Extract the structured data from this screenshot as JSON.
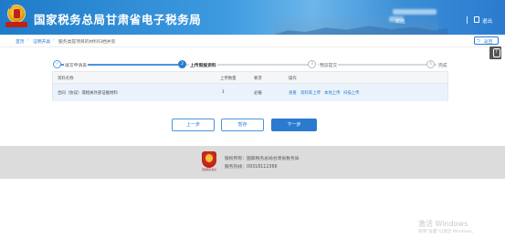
{
  "header": {
    "title": "国家税务总局甘肃省电子税务局",
    "welcome": "欢迎,",
    "logout": "退出"
  },
  "breadcrumb": {
    "items": [
      "首页",
      "证明开具",
      "服务类提项目的材料归档并装"
    ]
  },
  "nav": {
    "back_label": "返回"
  },
  "stepper": {
    "steps": [
      {
        "label": "填写申请表",
        "state": "done",
        "mark": "✓"
      },
      {
        "label": "上传照报资料",
        "state": "active",
        "mark": "2"
      },
      {
        "label": "预览提交",
        "state": "pending",
        "mark": "3"
      },
      {
        "label": "完成",
        "state": "pending",
        "mark": "4"
      }
    ],
    "colors": {
      "active": "#2a7bd0",
      "done": "#4a95dc",
      "pending": "#bbbbbb"
    }
  },
  "table": {
    "columns": [
      "资料名称",
      "上传数量",
      "要求",
      "操作"
    ],
    "rows": [
      {
        "name": "合同（协议）或相关外部证据材料",
        "count": "1",
        "requirement": "必报",
        "actions": [
          "查看",
          "资料库上传",
          "本地上传",
          "扫描上传"
        ]
      }
    ]
  },
  "buttons": {
    "prev": "上一步",
    "save": "暂存",
    "next": "下一步"
  },
  "footer": {
    "logo_caption": "国家税务总局",
    "owner": "版权所有：国家税务总局甘肃省税务局",
    "hotline": "服务热线：09318112366"
  },
  "watermark": {
    "line1": "激活 Windows",
    "line2": "转到\"设置\"以激活 Windows。"
  },
  "colors": {
    "brand": "#2a7bd0",
    "header_gradient": [
      "#1f7bc9",
      "#6cb6ea"
    ],
    "footer_bg": "#dcdcdc"
  }
}
